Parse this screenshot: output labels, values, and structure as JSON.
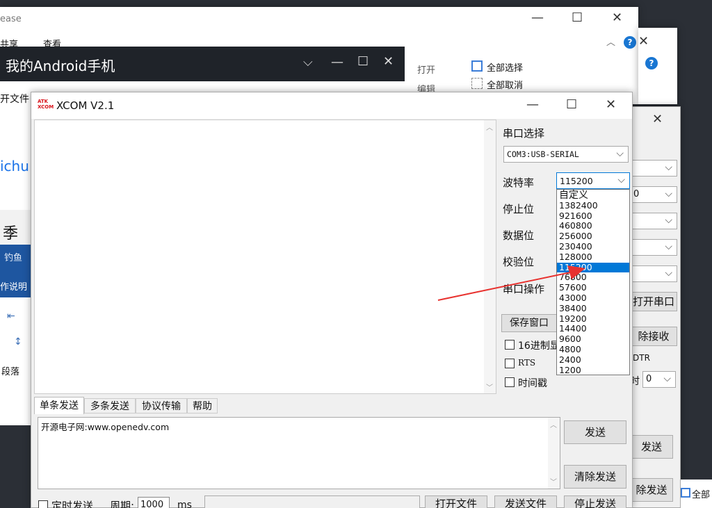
{
  "background": {
    "win1_title_partial": "ease",
    "ribbon_tab_share": "共享",
    "ribbon_tab_view": "查看",
    "ribbon_open": "打开",
    "ribbon_edit": "编辑",
    "ribbon_select_all": "全部选择",
    "ribbon_select_none": "全部取消",
    "left_text_open_file": "开文件",
    "left_link": "ichu",
    "left_heading": "季",
    "left_blue1": "钓鱼",
    "left_blue2": "作说明",
    "left_paragraph": "段落",
    "right_open_port": "打开串口",
    "right_clear_recv": "除接收",
    "right_dtr": "DTR",
    "right_time": "时",
    "right_time_value": "0",
    "right_send": "发送",
    "right_clear_send": "除发送",
    "right_value_partial": "0",
    "bottom_right_select_all": "全部"
  },
  "phone_window": {
    "title": "我的Android手机"
  },
  "xcom": {
    "title": "XCOM V2.1",
    "logo_top": "ATK",
    "logo_bottom": "XCOM",
    "port_label": "串口选择",
    "port_value": "COM3:USB-SERIAL",
    "baud_label": "波特率",
    "baud_value": "115200",
    "stop_label": "停止位",
    "data_label": "数据位",
    "parity_label": "校验位",
    "port_op_label": "串口操作",
    "save_window": "保存窗口",
    "hex_display": "16进制显",
    "rts": "RTS",
    "timestamp": "时间戳",
    "tabs": [
      "单条发送",
      "多条发送",
      "协议传输",
      "帮助"
    ],
    "send_text": "开源电子网:www.openedv.com",
    "send_button": "发送",
    "clear_send_button": "清除发送",
    "timed_send": "定时发送",
    "period_label": "周期:",
    "period_value": "1000",
    "ms": "ms",
    "open_file": "打开文件",
    "send_file": "发送文件",
    "stop_send": "停止发送"
  },
  "baud_options": [
    "自定义",
    "1382400",
    "921600",
    "460800",
    "256000",
    "230400",
    "128000",
    "115200",
    "76800",
    "57600",
    "43000",
    "38400",
    "19200",
    "14400",
    "9600",
    "4800",
    "2400",
    "1200"
  ],
  "baud_selected_index": 7,
  "colors": {
    "accent": "#0078d7",
    "arrow": "#e8322f",
    "phone_titlebar": "#1f2329"
  }
}
